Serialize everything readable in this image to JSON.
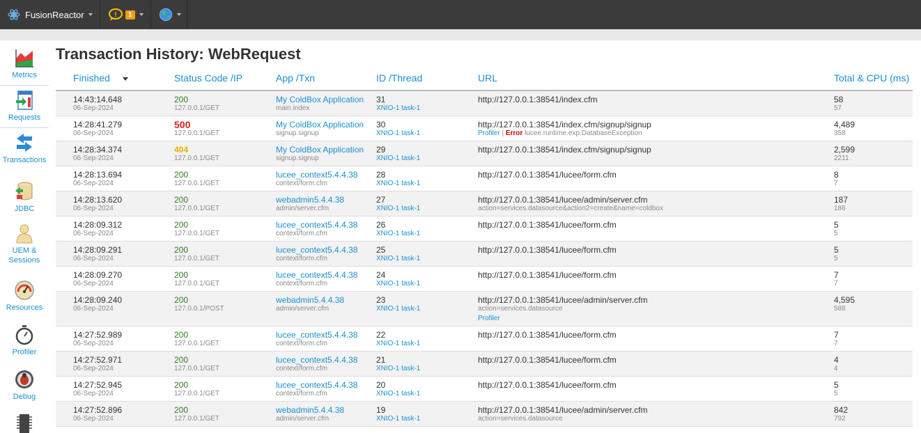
{
  "topbar": {
    "brand": "FusionReactor",
    "notification_count": "1"
  },
  "sidebar": [
    {
      "label": "Metrics",
      "icon": "metrics-chart-icon"
    },
    {
      "label": "Requests",
      "icon": "requests-page-icon",
      "active": true
    },
    {
      "label": "Transactions",
      "icon": "transactions-arrows-icon"
    },
    {
      "label": "JDBC",
      "icon": "database-icon"
    },
    {
      "label": "UEM &",
      "label2": "Sessions",
      "icon": "user-icon"
    },
    {
      "label": "Resources",
      "icon": "gauge-icon"
    },
    {
      "label": "Profiler",
      "icon": "stopwatch-icon"
    },
    {
      "label": "Debug",
      "icon": "debug-bug-icon"
    }
  ],
  "title": "Transaction History: WebRequest",
  "columns": {
    "finished": "Finished",
    "status": "Status Code /IP",
    "app": "App /Txn",
    "id": "ID /Thread",
    "url": "URL",
    "total": "Total & CPU (ms)"
  },
  "rows": [
    {
      "time": "14:43:14.648",
      "date": "06-Sep-2024",
      "code": "200",
      "ip": "127.0.0.1/GET",
      "app": "My ColdBox Application",
      "txn": "main.index",
      "id": "31",
      "thread": "XNIO-1 task-1",
      "url": "http://127.0.0.1:38541/index.cfm",
      "total": "58",
      "cpu": "57"
    },
    {
      "time": "14:28:41.279",
      "date": "06-Sep-2024",
      "code": "500",
      "ip": "127.0.0.1/GET",
      "app": "My ColdBox Application",
      "txn": "signup.signup",
      "id": "30",
      "thread": "XNIO-1 task-1",
      "url": "http://127.0.0.1:38541/index.cfm/signup/signup",
      "profiler": "Profiler",
      "sep": " | ",
      "error": "Error",
      "error_text": " lucee.runtime.exp.DatabaseException",
      "total": "4,489",
      "cpu": "358"
    },
    {
      "time": "14:28:34.374",
      "date": "06-Sep-2024",
      "code": "404",
      "ip": "127.0.0.1/GET",
      "app": "My ColdBox Application",
      "txn": "signup.signup",
      "id": "29",
      "thread": "XNIO-1 task-1",
      "url": "http://127.0.0.1:38541/index.cfm/signup/signup",
      "total": "2,599",
      "cpu": "2211"
    },
    {
      "time": "14:28:13.694",
      "date": "06-Sep-2024",
      "code": "200",
      "ip": "127.0.0.1/GET",
      "app": "lucee_context5.4.4.38",
      "txn": "context/form.cfm",
      "id": "28",
      "thread": "XNIO-1 task-1",
      "url": "http://127.0.0.1:38541/lucee/form.cfm",
      "total": "8",
      "cpu": "7"
    },
    {
      "time": "14:28:13.620",
      "date": "06-Sep-2024",
      "code": "200",
      "ip": "127.0.0.1/GET",
      "app": "webadmin5.4.4.38",
      "txn": "admin/server.cfm",
      "id": "27",
      "thread": "XNIO-1 task-1",
      "url": "http://127.0.0.1:38541/lucee/admin/server.cfm",
      "url_params": "action=services.datasource&action2=create&name=coldbox",
      "total": "187",
      "cpu": "186"
    },
    {
      "time": "14:28:09.312",
      "date": "06-Sep-2024",
      "code": "200",
      "ip": "127.0.0.1/GET",
      "app": "lucee_context5.4.4.38",
      "txn": "context/form.cfm",
      "id": "26",
      "thread": "XNIO-1 task-1",
      "url": "http://127.0.0.1:38541/lucee/form.cfm",
      "total": "5",
      "cpu": "5"
    },
    {
      "time": "14:28:09.291",
      "date": "06-Sep-2024",
      "code": "200",
      "ip": "127.0.0.1/GET",
      "app": "lucee_context5.4.4.38",
      "txn": "context/form.cfm",
      "id": "25",
      "thread": "XNIO-1 task-1",
      "url": "http://127.0.0.1:38541/lucee/form.cfm",
      "total": "5",
      "cpu": "5"
    },
    {
      "time": "14:28:09.270",
      "date": "06-Sep-2024",
      "code": "200",
      "ip": "127.0.0.1/GET",
      "app": "lucee_context5.4.4.38",
      "txn": "context/form.cfm",
      "id": "24",
      "thread": "XNIO-1 task-1",
      "url": "http://127.0.0.1:38541/lucee/form.cfm",
      "total": "7",
      "cpu": "7"
    },
    {
      "time": "14:28:09.240",
      "date": "06-Sep-2024",
      "code": "200",
      "ip": "127.0.0.1/POST",
      "app": "webadmin5.4.4.38",
      "txn": "admin/server.cfm",
      "id": "23",
      "thread": "XNIO-1 task-1",
      "url": "http://127.0.0.1:38541/lucee/admin/server.cfm",
      "url_params": "action=services.datasource",
      "profiler": "Profiler",
      "total": "4,595",
      "cpu": "588"
    },
    {
      "time": "14:27:52.989",
      "date": "06-Sep-2024",
      "code": "200",
      "ip": "127.0.0.1/GET",
      "app": "lucee_context5.4.4.38",
      "txn": "context/form.cfm",
      "id": "22",
      "thread": "XNIO-1 task-1",
      "url": "http://127.0.0.1:38541/lucee/form.cfm",
      "total": "7",
      "cpu": "7"
    },
    {
      "time": "14:27:52.971",
      "date": "06-Sep-2024",
      "code": "200",
      "ip": "127.0.0.1/GET",
      "app": "lucee_context5.4.4.38",
      "txn": "context/form.cfm",
      "id": "21",
      "thread": "XNIO-1 task-1",
      "url": "http://127.0.0.1:38541/lucee/form.cfm",
      "total": "4",
      "cpu": "4"
    },
    {
      "time": "14:27:52.945",
      "date": "06-Sep-2024",
      "code": "200",
      "ip": "127.0.0.1/GET",
      "app": "lucee_context5.4.4.38",
      "txn": "context/form.cfm",
      "id": "20",
      "thread": "XNIO-1 task-1",
      "url": "http://127.0.0.1:38541/lucee/form.cfm",
      "total": "5",
      "cpu": "5"
    },
    {
      "time": "14:27:52.896",
      "date": "06-Sep-2024",
      "code": "200",
      "ip": "127.0.0.1/GET",
      "app": "webadmin5.4.4.38",
      "txn": "admin/server.cfm",
      "id": "19",
      "thread": "XNIO-1 task-1",
      "url": "http://127.0.0.1:38541/lucee/admin/server.cfm",
      "url_params": "action=services.datasource",
      "total": "842",
      "cpu": "792"
    }
  ],
  "colors": {
    "accent": "#1a8fd6",
    "ok": "#2e7d1e",
    "server_error": "#e02020",
    "not_found": "#e8b000",
    "topbar": "#3b3b3b"
  }
}
